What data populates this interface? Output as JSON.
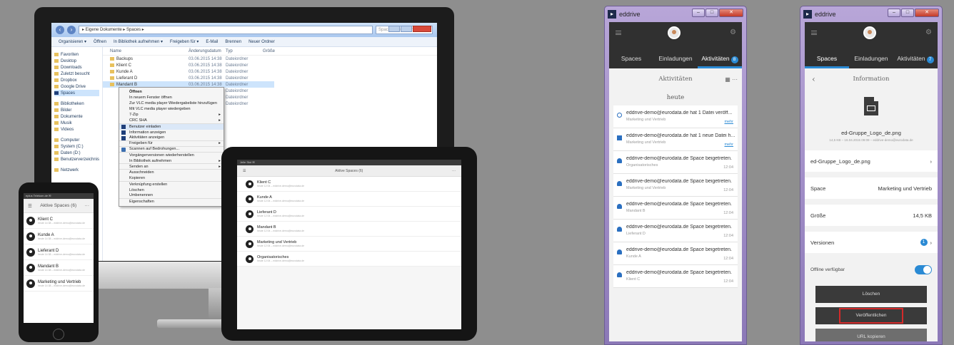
{
  "explorer": {
    "breadcrumb": "▸ Eigene Dokumente ▸ Spaces ▸",
    "search_placeholder": "Spaces durchsuchen",
    "toolbar": [
      "Organisieren ▾",
      "Öffnen",
      "In Bibliothek aufnehmen ▾",
      "Freigeben für ▾",
      "E-Mail",
      "Brennen",
      "Neuer Ordner"
    ],
    "nav": {
      "favorites": [
        "Favoriten",
        "Desktop",
        "Downloads",
        "Zuletzt besucht",
        "Dropbox",
        "Google Drive",
        "Spaces"
      ],
      "libraries": [
        "Bibliotheken",
        "Bilder",
        "Dokumente",
        "Musik",
        "Videos"
      ],
      "computer": [
        "Computer",
        "System (C:)",
        "Daten (D:)",
        "Benutzerverzeichnis"
      ],
      "network": "Netzwerk"
    },
    "columns": [
      "Name",
      "Änderungsdatum",
      "Typ",
      "Größe"
    ],
    "rows": [
      {
        "name": "Backups",
        "date": "03.06.2015 14:38",
        "type": "Dateiordner"
      },
      {
        "name": "Klient C",
        "date": "03.06.2015 14:38",
        "type": "Dateiordner"
      },
      {
        "name": "Kunde A",
        "date": "03.06.2015 14:38",
        "type": "Dateiordner"
      },
      {
        "name": "Lieferant D",
        "date": "03.06.2015 14:38",
        "type": "Dateiordner"
      },
      {
        "name": "Mandant B",
        "date": "03.06.2015 14:38",
        "type": "Dateiordner"
      },
      {
        "name": "",
        "date": "",
        "type": "Dateiordner"
      },
      {
        "name": "",
        "date": "",
        "type": "Dateiordner"
      },
      {
        "name": "",
        "date": "",
        "type": "Dateiordner"
      }
    ],
    "context_menu": [
      "Öffnen",
      "In neuem Fenster öffnen",
      "Zur VLC media player Wiedergabeliste hinzufügen",
      "Mit VLC media player wiedergeben",
      "7-Zip",
      "CRC SHA",
      "Benutzer einladen",
      "Information anzeigen",
      "Aktivitäten anzeigen",
      "Freigeben für",
      "Scannen auf Bedrohungen...",
      "Vorgängerversionen wiederherstellen",
      "In Bibliothek aufnehmen",
      "Senden an",
      "Ausschneiden",
      "Kopieren",
      "Verknüpfung erstellen",
      "Löschen",
      "Umbenennen",
      "Eigenschaften"
    ]
  },
  "phone": {
    "status": "eplus Telekom.de  ✉",
    "header": "Aktive Spaces (6)",
    "spaces": [
      {
        "name": "Klient C",
        "sub": "heute 14:38 – eddrive-demo@eurodata.de"
      },
      {
        "name": "Kunde A",
        "sub": "heute 14:38 – eddrive-demo@eurodata.de"
      },
      {
        "name": "Lieferant D",
        "sub": "heute 14:38 – eddrive-demo@eurodata.de"
      },
      {
        "name": "Mandant B",
        "sub": "heute 14:38 – eddrive-demo@eurodata.de"
      },
      {
        "name": "Marketing und Vertrieb",
        "sub": "heute 14:38 – eddrive-demo@eurodata.de"
      }
    ]
  },
  "tablet": {
    "status": "Jelle Stol ✉",
    "header": "Aktive Spaces (6)",
    "spaces": [
      {
        "name": "Klient C",
        "sub": "heute 12:04 – eddrive-demo@eurodata.de"
      },
      {
        "name": "Kunde A",
        "sub": "heute 12:04 – eddrive-demo@eurodata.de"
      },
      {
        "name": "Lieferant D",
        "sub": "heute 12:04 – eddrive-demo@eurodata.de"
      },
      {
        "name": "Mandant B",
        "sub": "heute 12:04 – eddrive-demo@eurodata.de"
      },
      {
        "name": "Marketing und Vertrieb",
        "sub": "heute 12:04 – eddrive-demo@eurodata.de"
      },
      {
        "name": "Organisatorisches",
        "sub": "heute 12:04 – eddrive-demo@eurodata.de"
      }
    ]
  },
  "window1": {
    "title": "eddrive",
    "tabs": [
      {
        "label": "Spaces"
      },
      {
        "label": "Einladungen"
      },
      {
        "label": "Aktivitäten",
        "badge": "8"
      }
    ],
    "subheader": "Aktivitäten",
    "day": "heute",
    "activities": [
      {
        "icon": "link-icon",
        "text": "eddrive-demo@eurodata.de hat 1 Datei veröff...",
        "space": "Marketing und Vertrieb",
        "action": "mehr"
      },
      {
        "icon": "file-icon",
        "text": "eddrive-demo@eurodata.de hat 1 neue Datei h...",
        "space": "Marketing und Vertrieb",
        "action": "mehr"
      },
      {
        "icon": "user-icon",
        "text": "eddrive-demo@eurodata.de Space beigetreten.",
        "space": "Organisatorisches",
        "time": "12:04"
      },
      {
        "icon": "user-icon",
        "text": "eddrive-demo@eurodata.de Space beigetreten.",
        "space": "Marketing und Vertrieb",
        "time": "12:04"
      },
      {
        "icon": "user-icon",
        "text": "eddrive-demo@eurodata.de Space beigetreten.",
        "space": "Mandant B",
        "time": "12:04"
      },
      {
        "icon": "user-icon",
        "text": "eddrive-demo@eurodata.de Space beigetreten.",
        "space": "Lieferant D",
        "time": "12:04"
      },
      {
        "icon": "user-icon",
        "text": "eddrive-demo@eurodata.de Space beigetreten.",
        "space": "Kunde A",
        "time": "12:04"
      },
      {
        "icon": "user-icon",
        "text": "eddrive-demo@eurodata.de Space beigetreten.",
        "space": "Klient C",
        "time": "12:04"
      }
    ]
  },
  "window2": {
    "title": "eddrive",
    "tabs": [
      {
        "label": "Spaces"
      },
      {
        "label": "Einladungen"
      },
      {
        "label": "Aktivitäten",
        "badge": "7"
      }
    ],
    "subheader": "Information",
    "file_name": "ed-Gruppe_Logo_de.png",
    "file_meta": "14,5 KB – 16.04.2015 09:09 – eddrive-demo@eurodata.de",
    "rows": [
      {
        "label": "ed-Gruppe_Logo_de.png",
        "value": "›"
      },
      {
        "label": "Space",
        "value": "Marketing und Vertrieb"
      },
      {
        "label": "Größe",
        "value": "14,5 KB"
      },
      {
        "label": "Versionen",
        "badge": "1",
        "value": "›"
      }
    ],
    "offline_label": "Offline verfügbar",
    "buttons": {
      "delete": "Löschen",
      "publish": "Veröffentlichen",
      "copy_url": "URL kopieren"
    }
  }
}
